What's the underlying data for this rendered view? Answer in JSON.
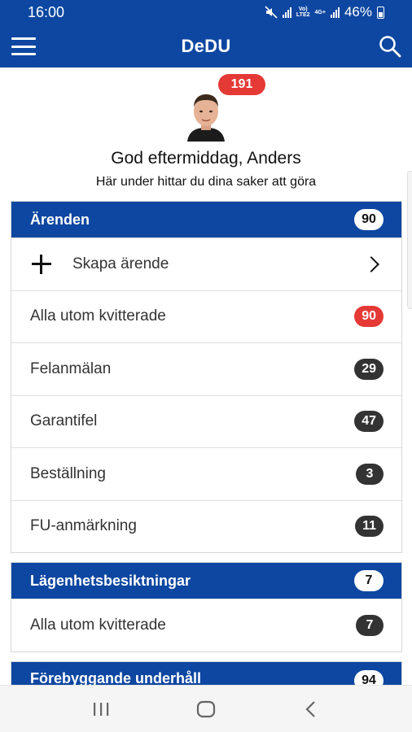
{
  "status_bar": {
    "time": "16:00",
    "network_label_top": "Vo)",
    "network_label_bottom": "LTE2",
    "network2_label": "4G+",
    "battery": "46%"
  },
  "app_bar": {
    "title": "DeDU"
  },
  "profile": {
    "notification_count": "191",
    "greeting": "God eftermiddag, Anders",
    "subtext": "Här under hittar du dina saker att göra"
  },
  "sections": {
    "arenden": {
      "title": "Ärenden",
      "count": "90",
      "create_label": "Skapa ärende",
      "items": [
        {
          "label": "Alla utom kvitterade",
          "count": "90"
        },
        {
          "label": "Felanmälan",
          "count": "29"
        },
        {
          "label": "Garantifel",
          "count": "47"
        },
        {
          "label": "Beställning",
          "count": "3"
        },
        {
          "label": "FU-anmärkning",
          "count": "11"
        }
      ]
    },
    "besiktningar": {
      "title": "Lägenhetsbesiktningar",
      "count": "7",
      "items": [
        {
          "label": "Alla utom kvitterade",
          "count": "7"
        }
      ]
    },
    "underhall": {
      "title": "Förebyggande underhåll",
      "count": "94"
    }
  },
  "colors": {
    "primary": "#0d47a1",
    "badge_red": "#e53935",
    "badge_dark": "#333333"
  },
  "icons": {
    "menu": "hamburger-menu-icon",
    "search": "search-icon",
    "add": "plus-icon",
    "chevron": "chevron-right-icon",
    "nav_recents": "recents-icon",
    "nav_home": "home-icon",
    "nav_back": "back-icon"
  }
}
